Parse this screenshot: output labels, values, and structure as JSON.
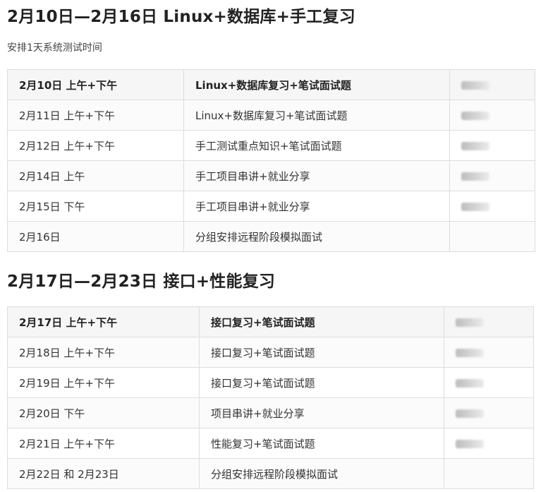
{
  "section1": {
    "title": "2月10日—2月16日 Linux+数据库+手工复习",
    "note": "安排1天系统测试时间",
    "rows": [
      {
        "date": "2月10日 上午+下午",
        "topic": "Linux+数据库复习+笔试面试题"
      },
      {
        "date": "2月11日 上午+下午",
        "topic": "Linux+数据库复习+笔试面试题"
      },
      {
        "date": "2月12日 上午+下午",
        "topic": "手工测试重点知识+笔试面试题"
      },
      {
        "date": "2月14日 上午",
        "topic": "手工项目串讲+就业分享"
      },
      {
        "date": "2月15日 下午",
        "topic": "手工项目串讲+就业分享"
      },
      {
        "date": "2月16日",
        "topic": "分组安排远程阶段模拟面试"
      }
    ]
  },
  "section2": {
    "title": "2月17日—2月23日 接口+性能复习",
    "rows": [
      {
        "date": "2月17日 上午+下午",
        "topic": "接口复习+笔试面试题"
      },
      {
        "date": "2月18日 上午+下午",
        "topic": "接口复习+笔试面试题"
      },
      {
        "date": "2月19日 上午+下午",
        "topic": "接口复习+笔试面试题"
      },
      {
        "date": "2月20日 下午",
        "topic": "项目串讲+就业分享"
      },
      {
        "date": "2月21日 上午+下午",
        "topic": "性能复习+笔试面试题"
      },
      {
        "date": "2月22日 和 2月23日",
        "topic": "分组安排远程阶段模拟面试"
      }
    ]
  }
}
